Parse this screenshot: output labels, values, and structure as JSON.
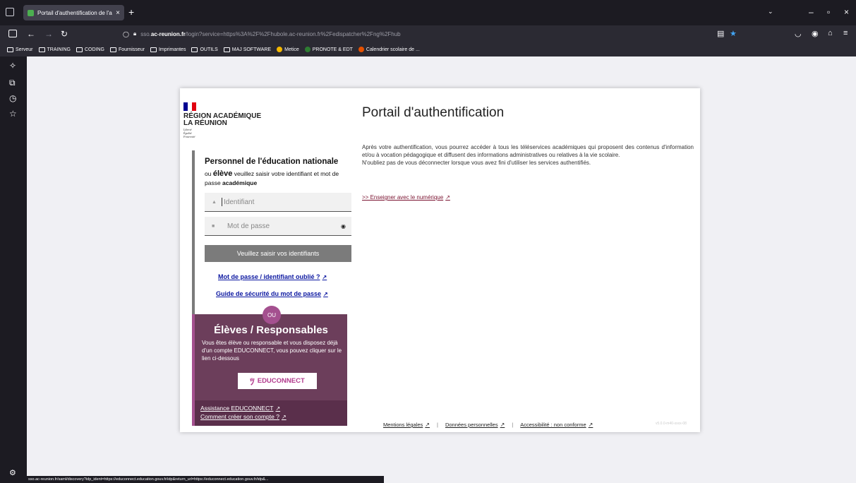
{
  "browser": {
    "tab_title": "Portail d'authentification de l'ac ×",
    "tab_label": "Portail d'authentification de l'a:",
    "new_tab": "+",
    "url_prefix": "sso.",
    "url_domain": "ac-reunion.fr",
    "url_path": "/login?service=https%3A%2F%2Fhubole.ac-reunion.fr%2Fedispatcher%2Fng%2Fhub",
    "bookmarks": [
      "Serveur",
      "TRAINING",
      "CODING",
      "Fournisseur",
      "Imprimantes",
      "OUTILS",
      "MAJ SOFTWARE",
      "Metice",
      "PRONOTE & EDT",
      "Calendrier scolaire de ..."
    ],
    "status_url": "sso.ac-reunion.fr/saml/discovery?idp_ident=https://educonnect.education.gouv.fr/idp&return_url=https://educonnect.education.gouv.fr/idp&..."
  },
  "header": {
    "region_line1": "RÉGION ACADÉMIQUE",
    "region_line2": "LA RÉUNION",
    "motto": [
      "Liberté",
      "Égalité",
      "Fraternité"
    ]
  },
  "login": {
    "title": "Personnel de l'éducation nationale",
    "sub_ou": "ou ",
    "sub_eleve": "élève",
    "sub_mid": " veuillez saisir votre identifiant et mot de passe ",
    "sub_acad": "académique",
    "username_placeholder": "Identifiant",
    "password_placeholder": "Mot de passe",
    "submit_label": "Veuillez saisir vos identifiants",
    "forgot_link": "Mot de passe / identifiant oublié ?",
    "guide_link": "Guide de sécurité du mot de passe"
  },
  "ou_label": "OU",
  "eleves": {
    "title": "Élèves / Responsables",
    "text": "Vous êtes élève ou responsable et vous disposez déjà d'un compte EDUCONNECT, vous pouvez cliquer sur le lien ci-dessous",
    "button_label": "EDUCONNECT",
    "assist_link": "Assistance EDUCONNECT",
    "create_link": "Comment créer son compte ?"
  },
  "main": {
    "title": "Portail d'authentification",
    "paragraph1": "Après votre authentification, vous pourrez accéder à tous les téléservices académiques qui proposent des contenus d'information et/ou à vocation pédagogique et diffusent des informations administratives ou relatives à la vie scolaire.",
    "paragraph2": "N'oubliez pas de vous déconnecter lorsque vous avez fini d'utiliser les services authentifiés.",
    "link": ">> Enseigner avec le numérique"
  },
  "footer": {
    "legal": "Mentions légales",
    "personal": "Données personnelles",
    "accessibility": "Accessibilité : non conforme",
    "separator": "|",
    "version": "v5.0.0-m40-xxxx-08"
  },
  "colors": {
    "eleves_bg": "#6c3e5b",
    "accent_purple": "#a4508f",
    "link_blue": "#0a16a0",
    "submit_gray": "#7b7b7b"
  }
}
